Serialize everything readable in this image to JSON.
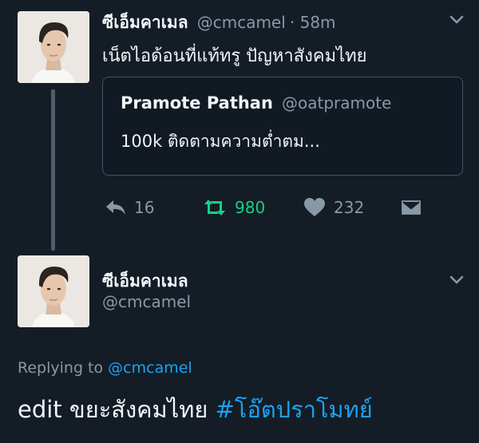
{
  "tweet": {
    "display_name": "ซีเอ็มคาเมล",
    "handle": "@cmcamel",
    "time": "· 58m",
    "text": "เน็ตไอด้อนที่แท้ทรู ปัญหาสังคมไทย",
    "quote": {
      "display_name": "Pramote Pathan",
      "handle": "@oatpramote",
      "text": "100k ติดตามความต่ำตม..."
    },
    "actions": {
      "reply_count": "16",
      "retweet_count": "980",
      "like_count": "232"
    }
  },
  "reply": {
    "display_name": "ซีเอ็มคาเมล",
    "handle": "@cmcamel",
    "replying_prefix": "Replying to",
    "replying_handle": "@cmcamel",
    "text": "edit ขยะสังคมไทย",
    "hashtag": "#โอ๊ตปราโมทย์"
  },
  "colors": {
    "background": "#141d26",
    "retweet_active": "#19cf86",
    "link": "#1da1f2",
    "muted": "#8899a6"
  },
  "icons": [
    "reply-icon",
    "retweet-icon",
    "like-icon",
    "direct-message-icon",
    "chevron-down-icon"
  ]
}
